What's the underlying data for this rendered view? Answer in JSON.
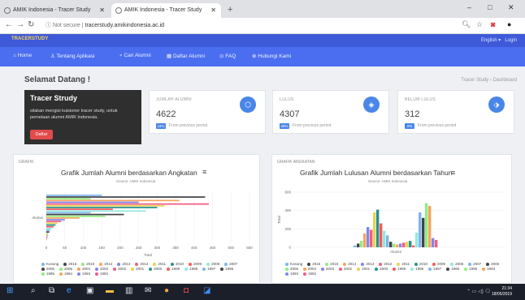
{
  "browser": {
    "tabs": [
      {
        "label": "AMIK Indonesia - Tracer Study"
      },
      {
        "label": "AMIK Indonesia - Tracer Study"
      }
    ],
    "new_tab": "+",
    "url_status": "Not secure",
    "url": "tracerstudy.amikindonesia.ac.id",
    "win_min": "–",
    "win_max": "□",
    "win_close": "✕"
  },
  "header": {
    "brand": "TRACERSTUDY",
    "lang": "English",
    "login": "Login"
  },
  "menu": [
    {
      "label": "Home"
    },
    {
      "label": "Tentang Aplikasi"
    },
    {
      "label": "Cari Alumni"
    },
    {
      "label": "Daftar Alumni"
    },
    {
      "label": "FAQ"
    },
    {
      "label": "Hubungi Kami"
    }
  ],
  "page": {
    "welcome": "Selamat Datang !",
    "breadcrumb": "Tracer Study  ›  Dashboard"
  },
  "intro_card": {
    "title": "Tracer Strudy",
    "text": "silakan mengisi kuisioner tracer study, untuk pemetaan alumni AMIK Indonesia.",
    "button": "Daftar"
  },
  "stats": [
    {
      "label": "JUMLAH ALUMNI",
      "value": "4622",
      "badge": "44%",
      "sub": "From previous period",
      "color": "#4a86e8"
    },
    {
      "label": "LULUS",
      "value": "4307",
      "badge": "28%",
      "sub": "From previous period",
      "color": "#4a86e8"
    },
    {
      "label": "BELUM LULUS",
      "value": "312",
      "badge": "0%",
      "sub": "From previous period",
      "color": "#4a86e8"
    }
  ],
  "panels": {
    "left": {
      "label": "GRAFIK",
      "title": "Grafik Jumlah Alumni berdasarkan Angkatan",
      "subtitle": "Source: AMIK Indonesia",
      "xlabel": "Total",
      "ylabel": "Alumni"
    },
    "right": {
      "label": "GRAFIK ANGKATAN",
      "title": "Grafik Jumlah Lulusan Alumni berdasarkan Tahun",
      "subtitle": "Source: AMIK Indonesia",
      "xlabel": "Alumni",
      "ylabel": "Total"
    }
  },
  "legend_years": [
    "Kosong",
    "2016",
    "2015",
    "2014",
    "2013",
    "2012",
    "2011",
    "2010",
    "2009",
    "2008",
    "2007",
    "2006",
    "2005",
    "2004",
    "2003",
    "2002",
    "2001",
    "2000",
    "1999",
    "1998",
    "1997",
    "1996",
    "1995",
    "1994",
    "1993",
    "1992"
  ],
  "legend_colors": [
    "#7cb5ec",
    "#434348",
    "#90ed7d",
    "#f7a35c",
    "#8085e9",
    "#f15c80",
    "#e4d354",
    "#2b908f",
    "#f45b5b",
    "#91e8e1",
    "#7cb5ec",
    "#434348",
    "#90ed7d",
    "#f7a35c",
    "#8085e9",
    "#f15c80",
    "#e4d354",
    "#2b908f",
    "#f45b5b",
    "#91e8e1",
    "#7cb5ec",
    "#434348",
    "#90ed7d",
    "#f7a35c",
    "#8085e9",
    "#f15c80"
  ],
  "chart_data": [
    {
      "type": "bar",
      "title": "Grafik Jumlah Alumni berdasarkan Angkatan",
      "subtitle": "Source: AMIK Indonesia",
      "orientation": "horizontal",
      "categories": [
        "Alumni"
      ],
      "xlabel": "Total",
      "xlim": [
        0,
        550
      ],
      "xticks": [
        0,
        50,
        100,
        150,
        200,
        250,
        300,
        350,
        400,
        450,
        500,
        550
      ],
      "values": [
        150,
        430,
        120,
        360,
        250,
        440,
        320,
        300,
        180,
        270,
        120,
        210,
        160,
        90,
        50,
        40,
        30,
        25,
        20,
        15,
        10,
        8,
        5,
        5,
        3,
        2
      ]
    },
    {
      "type": "bar",
      "title": "Grafik Jumlah Lulusan Alumni berdasarkan Tahun",
      "subtitle": "Source: AMIK Indonesia",
      "xlabel": "Alumni",
      "ylabel": "Total",
      "ylim": [
        0,
        600
      ],
      "yticks": [
        0,
        200,
        400,
        600
      ],
      "values": [
        20,
        40,
        70,
        150,
        220,
        190,
        380,
        410,
        260,
        180,
        130,
        60,
        40,
        30,
        40,
        50,
        60,
        70,
        20,
        160,
        380,
        320,
        480,
        450,
        100,
        80
      ]
    }
  ],
  "taskbar": {
    "time": "21:34",
    "date": "18/05/2019"
  }
}
